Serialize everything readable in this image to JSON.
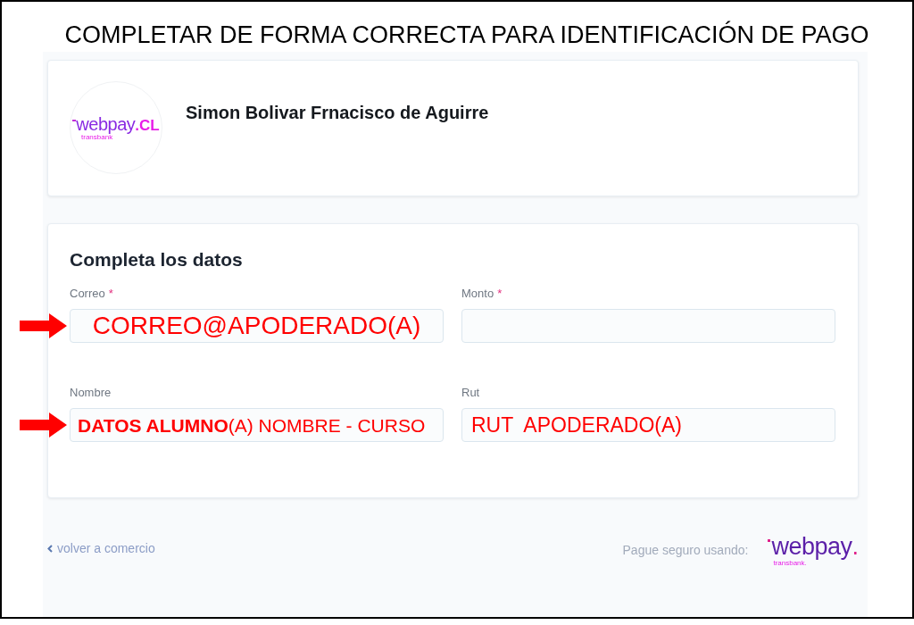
{
  "annotation": {
    "title": "COMPLETAR DE FORMA CORRECTA PARA IDENTIFICACIÓN DE PAGO"
  },
  "merchant": {
    "logo": {
      "wordmark": "webpay",
      "suffix": ".CL",
      "tagline": "transbank"
    },
    "name": "Simon Bolivar Frnacisco de Aguirre"
  },
  "form": {
    "title": "Completa los datos",
    "fields": [
      {
        "kind": "email",
        "label": "Correo",
        "required_mark": "*",
        "value": "CORREO@APODERADO(A)",
        "arrow": true
      },
      {
        "kind": "amount",
        "label": "Monto",
        "required_mark": "*",
        "arrow": false
      },
      {
        "kind": "name",
        "label": "Nombre",
        "value": "**DATOS ALUMNO**(A) NOMBRE - CURSO",
        "arrow": true
      },
      {
        "kind": "rut",
        "label": "Rut",
        "value": "RUT  APODERADO(A)",
        "arrow": false
      }
    ]
  },
  "footer": {
    "back_link": "volver a comercio",
    "secure_text": "Pague seguro usando:",
    "logo": {
      "wordmark": "webpay",
      "suffix": ".",
      "tagline": "transbank."
    }
  }
}
